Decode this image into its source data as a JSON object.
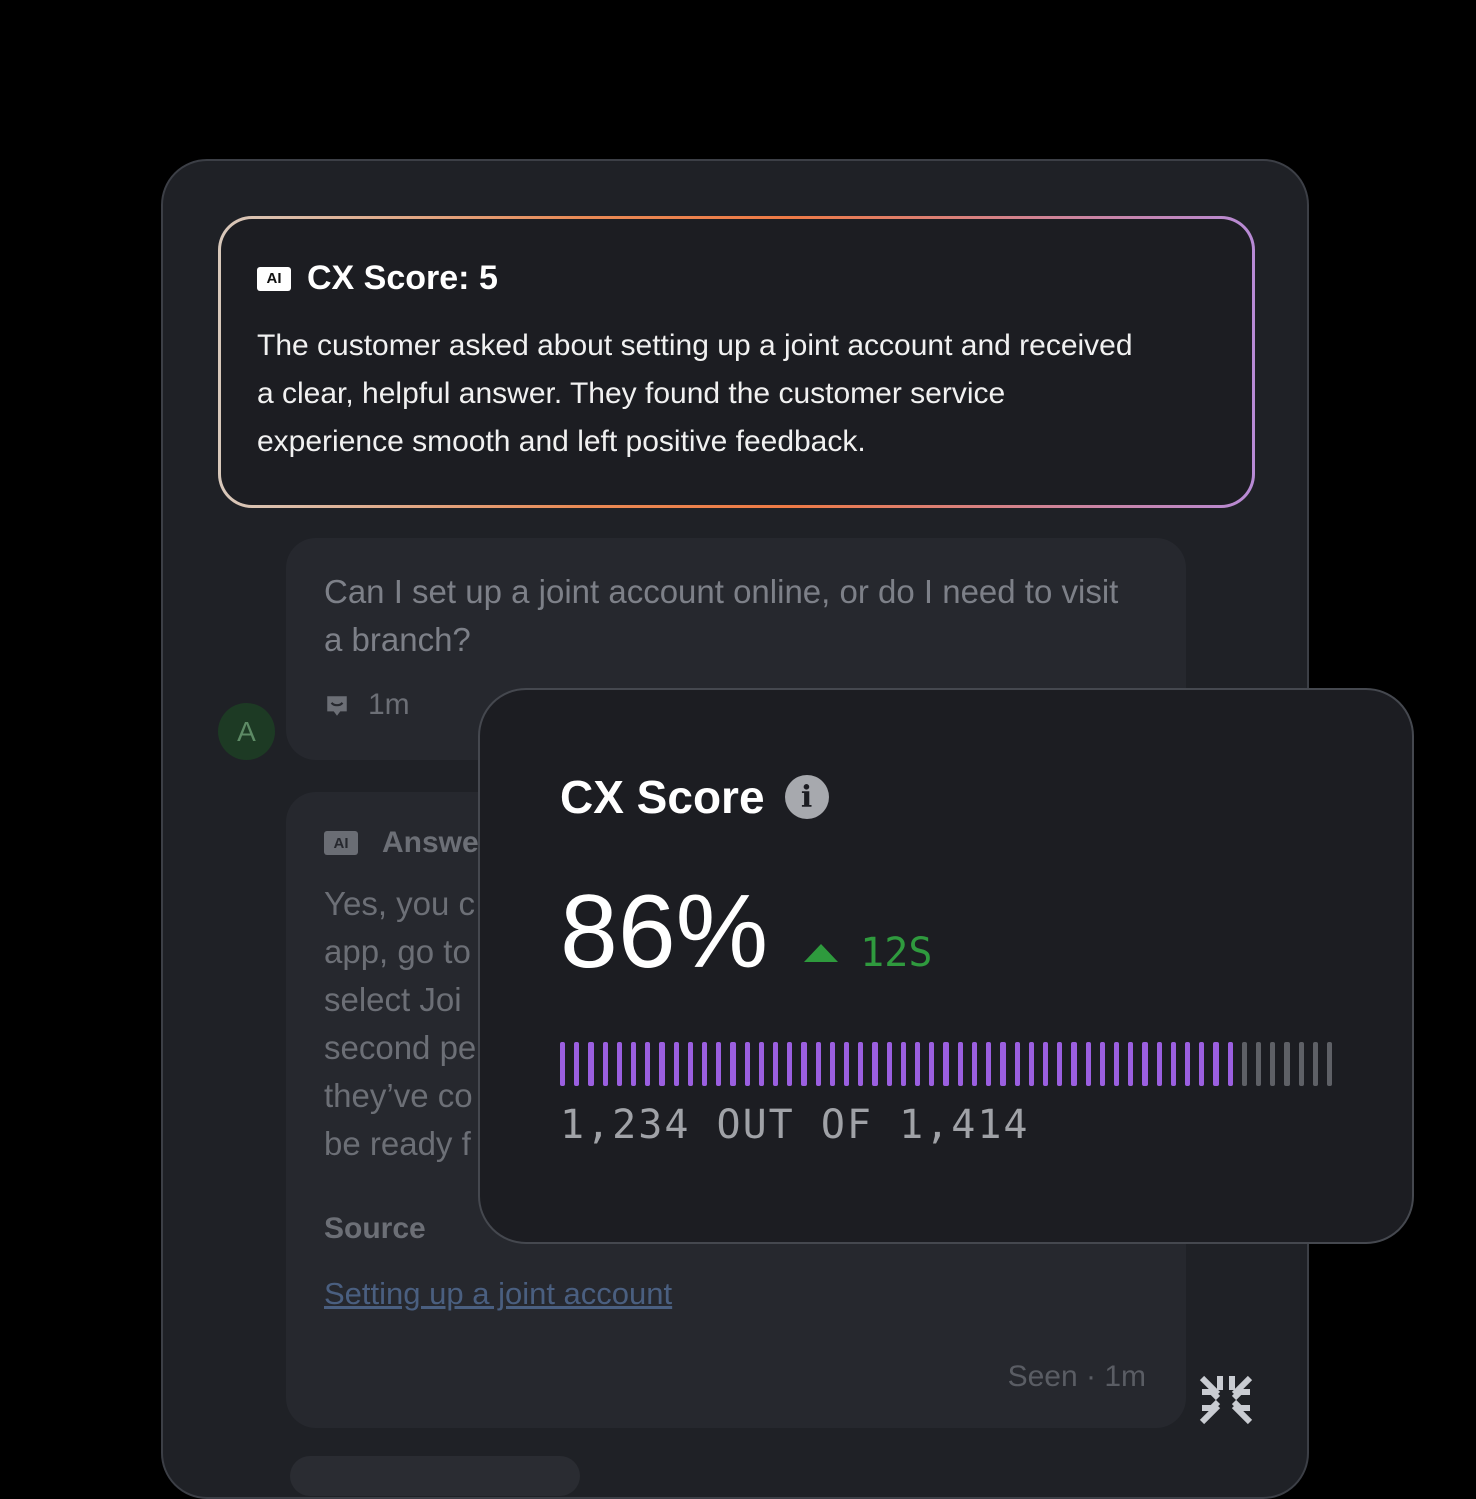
{
  "summary": {
    "badge": "AI",
    "title": "CX Score: 5",
    "text": "The customer asked about setting up a joint account and received a clear, helpful answer. They found the customer service experience smooth and left positive feedback."
  },
  "question": {
    "text": "Can I set up a joint account online, or do I need to visit a branch?",
    "time": "1m"
  },
  "avatar": {
    "initial": "A"
  },
  "answer": {
    "badge": "AI",
    "title": "Answe",
    "lines": [
      "Yes, you c",
      "app, go to",
      "select Joi",
      "second pe",
      "they’ve co",
      "be ready f"
    ],
    "source_label": "Source",
    "source_link": "Setting up a joint account",
    "seen": "Seen · 1m"
  },
  "score_card": {
    "title": "CX Score",
    "value": "86%",
    "delta": "12S",
    "caption": "1,234 OUT OF 1,414",
    "fill_fraction": 0.873,
    "total_bars": 55,
    "colors": {
      "filled": "#9b5fe0",
      "empty": "#5e6066",
      "delta": "#2f9a3e"
    }
  },
  "icons": [
    "ai-badge",
    "chat-icon",
    "info-icon",
    "brand-logo"
  ]
}
